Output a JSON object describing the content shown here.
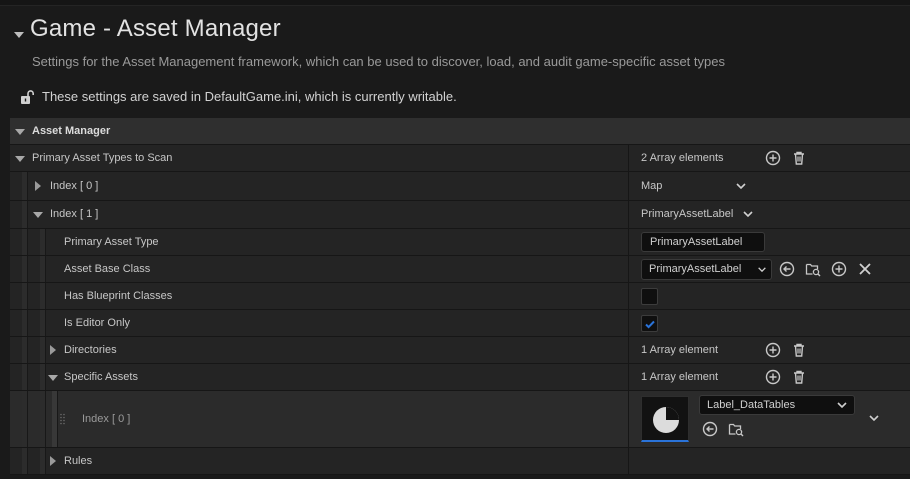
{
  "header": {
    "title": "Game - Asset Manager",
    "description": "Settings for the Asset Management framework, which can be used to discover, load, and audit game-specific asset types",
    "writable_note": "These settings are saved in DefaultGame.ini, which is currently writable."
  },
  "section": {
    "label": "Asset Manager"
  },
  "rows": {
    "primary_types": {
      "label": "Primary Asset Types to Scan",
      "value": "2 Array elements"
    },
    "index0": {
      "label": "Index [ 0 ]",
      "value": "Map"
    },
    "index1": {
      "label": "Index [ 1 ]",
      "value": "PrimaryAssetLabel"
    },
    "primary_asset_type": {
      "label": "Primary Asset Type",
      "value": "PrimaryAssetLabel"
    },
    "asset_base_class": {
      "label": "Asset Base Class",
      "value": "PrimaryAssetLabel"
    },
    "has_blueprint_classes": {
      "label": "Has Blueprint Classes",
      "checked": false
    },
    "is_editor_only": {
      "label": "Is Editor Only",
      "checked": true
    },
    "directories": {
      "label": "Directories",
      "value": "1 Array element"
    },
    "specific_assets": {
      "label": "Specific Assets",
      "value": "1 Array element"
    },
    "specific_index0": {
      "label": "Index [ 0 ]",
      "asset": "Label_DataTables"
    },
    "rules": {
      "label": "Rules"
    }
  },
  "colors": {
    "accent": "#2a73d9",
    "background": "#1a1a1a",
    "row": "#242424",
    "section": "#2f2f2f"
  },
  "icons": [
    "lock-open-icon",
    "add-icon",
    "trash-icon",
    "chevron-down-icon",
    "use-selected-icon",
    "browse-icon",
    "clear-icon",
    "checkmark-icon",
    "asset-thumbnail-icon",
    "drag-grip-icon"
  ]
}
